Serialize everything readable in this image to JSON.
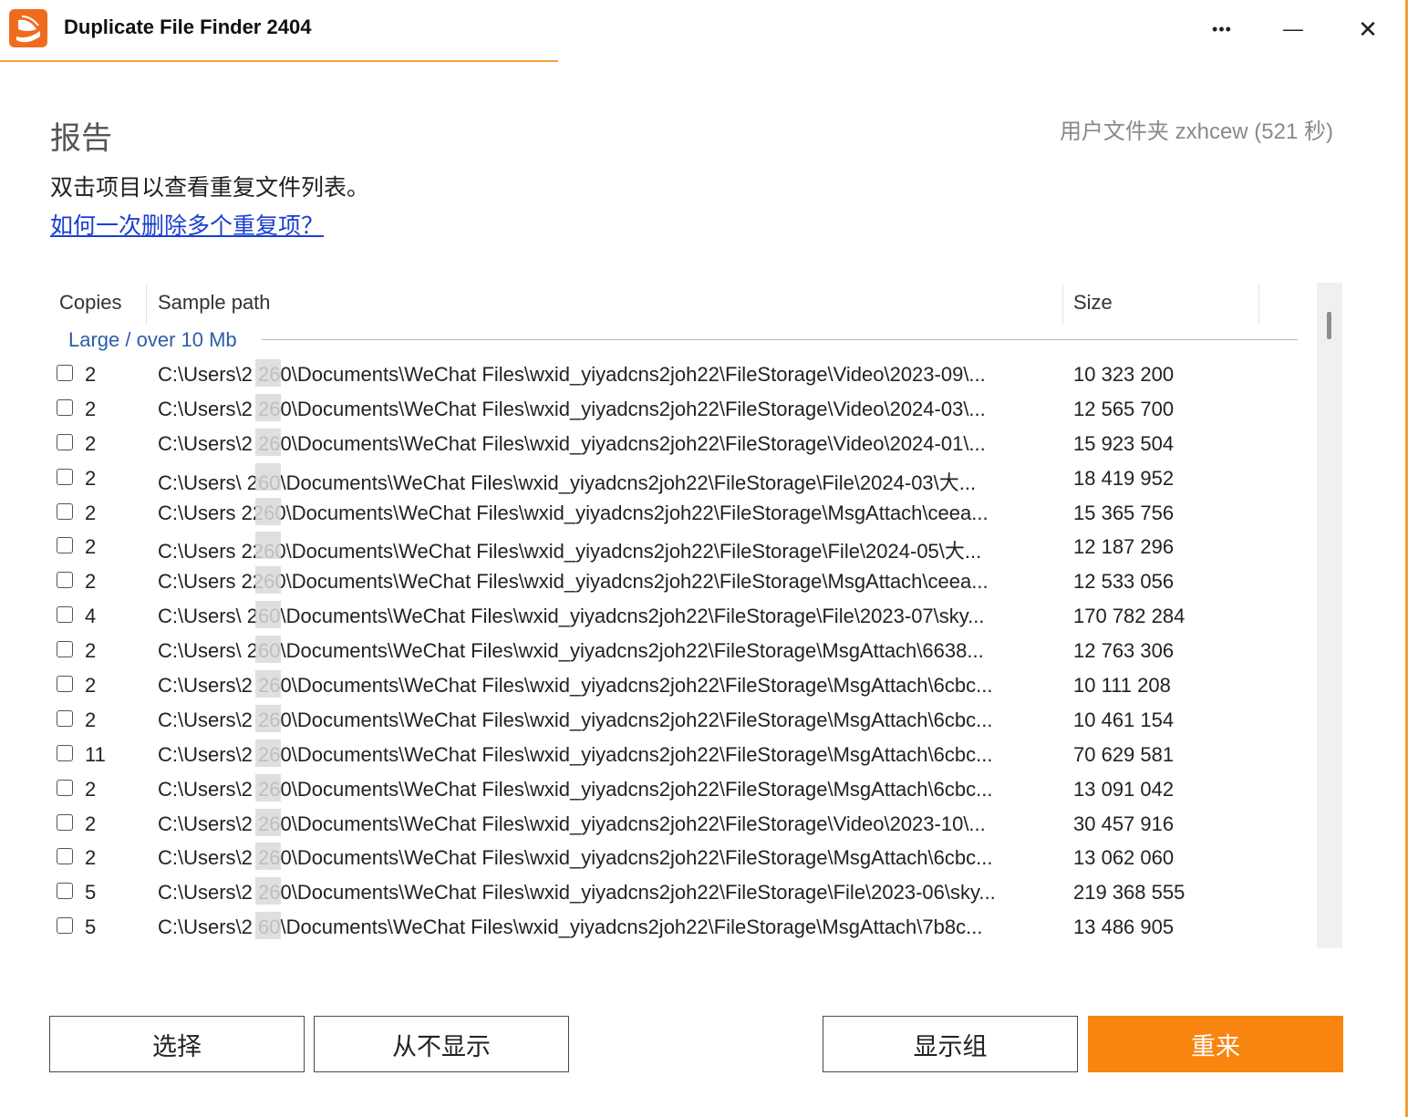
{
  "window": {
    "title": "Duplicate File Finder 2404",
    "more_glyph": "•••",
    "minimize_glyph": "—",
    "close_glyph": "✕"
  },
  "header": {
    "title": "报告",
    "folder_info": "用户文件夹 zxhcew (521 秒)",
    "instruction": "双击项目以查看重复文件列表。",
    "help_link": "如何一次删除多个重复项？"
  },
  "table": {
    "columns": {
      "copies": "Copies",
      "path": "Sample path",
      "size": "Size"
    },
    "group_label": "Large / over 10 Mb",
    "rows": [
      {
        "copies": "2",
        "path": "C:\\Users\\2  260\\Documents\\WeChat Files\\wxid_yiyadcns2joh22\\FileStorage\\Video\\2023-09\\...",
        "size": "10 323 200"
      },
      {
        "copies": "2",
        "path": "C:\\Users\\2  260\\Documents\\WeChat Files\\wxid_yiyadcns2joh22\\FileStorage\\Video\\2024-03\\...",
        "size": "12 565 700"
      },
      {
        "copies": "2",
        "path": "C:\\Users\\2  260\\Documents\\WeChat Files\\wxid_yiyadcns2joh22\\FileStorage\\Video\\2024-01\\...",
        "size": "15 923 504"
      },
      {
        "copies": "2",
        "path": "C:\\Users\\   260\\Documents\\WeChat Files\\wxid_yiyadcns2joh22\\FileStorage\\File\\2024-03\\大...",
        "size": "18 419 952"
      },
      {
        "copies": "2",
        "path": "C:\\Users   2260\\Documents\\WeChat Files\\wxid_yiyadcns2joh22\\FileStorage\\MsgAttach\\ceea...",
        "size": "15 365 756"
      },
      {
        "copies": "2",
        "path": "C:\\Users   2260\\Documents\\WeChat Files\\wxid_yiyadcns2joh22\\FileStorage\\File\\2024-05\\大...",
        "size": "12 187 296"
      },
      {
        "copies": "2",
        "path": "C:\\Users   2260\\Documents\\WeChat Files\\wxid_yiyadcns2joh22\\FileStorage\\MsgAttach\\ceea...",
        "size": "12 533 056"
      },
      {
        "copies": "4",
        "path": "C:\\Users\\   260\\Documents\\WeChat Files\\wxid_yiyadcns2joh22\\FileStorage\\File\\2023-07\\sky...",
        "size": "170 782 284"
      },
      {
        "copies": "2",
        "path": "C:\\Users\\   260\\Documents\\WeChat Files\\wxid_yiyadcns2joh22\\FileStorage\\MsgAttach\\6638...",
        "size": "12 763 306"
      },
      {
        "copies": "2",
        "path": "C:\\Users\\2  260\\Documents\\WeChat Files\\wxid_yiyadcns2joh22\\FileStorage\\MsgAttach\\6cbc...",
        "size": "10 111 208"
      },
      {
        "copies": "2",
        "path": "C:\\Users\\2  260\\Documents\\WeChat Files\\wxid_yiyadcns2joh22\\FileStorage\\MsgAttach\\6cbc...",
        "size": "10 461 154"
      },
      {
        "copies": "11",
        "path": "C:\\Users\\2  260\\Documents\\WeChat Files\\wxid_yiyadcns2joh22\\FileStorage\\MsgAttach\\6cbc...",
        "size": "70 629 581"
      },
      {
        "copies": "2",
        "path": "C:\\Users\\2  260\\Documents\\WeChat Files\\wxid_yiyadcns2joh22\\FileStorage\\MsgAttach\\6cbc...",
        "size": "13 091 042"
      },
      {
        "copies": "2",
        "path": "C:\\Users\\2  260\\Documents\\WeChat Files\\wxid_yiyadcns2joh22\\FileStorage\\Video\\2023-10\\...",
        "size": "30 457 916"
      },
      {
        "copies": "2",
        "path": "C:\\Users\\2  260\\Documents\\WeChat Files\\wxid_yiyadcns2joh22\\FileStorage\\MsgAttach\\6cbc...",
        "size": "13 062 060"
      },
      {
        "copies": "5",
        "path": "C:\\Users\\2  260\\Documents\\WeChat Files\\wxid_yiyadcns2joh22\\FileStorage\\File\\2023-06\\sky...",
        "size": "219 368 555"
      },
      {
        "copies": "5",
        "path": "C:\\Users\\2  60\\Documents\\WeChat Files\\wxid_yiyadcns2joh22\\FileStorage\\MsgAttach\\7b8c...",
        "size": "13 486 905"
      }
    ]
  },
  "buttons": {
    "select": "选择",
    "never_show": "从不显示",
    "show_group": "显示组",
    "restart": "重来"
  },
  "colors": {
    "accent": "#f7850f",
    "link": "#1a3fd0",
    "group_label": "#2c5ea8"
  },
  "icons": {
    "app": "app-logo-icon",
    "more": "more-icon",
    "minimize": "minimize-icon",
    "close": "close-icon"
  }
}
